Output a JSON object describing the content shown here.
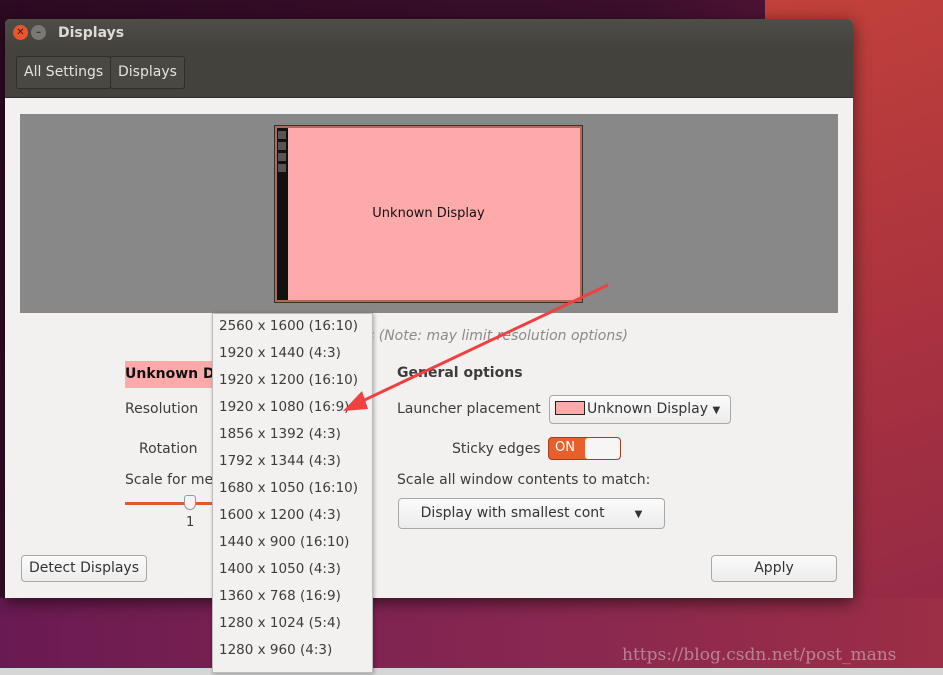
{
  "window": {
    "title": "Displays"
  },
  "toolbar": {
    "all_settings": "All Settings",
    "displays": "Displays"
  },
  "preview": {
    "monitor_label": "Unknown Display"
  },
  "note": "s (Note: may limit resolution options)",
  "display": {
    "name": "Unknown Di",
    "resolution_label": "Resolution",
    "rotation_label": "Rotation",
    "scale_label": "Scale for mer",
    "scale_value": "1"
  },
  "general": {
    "title": "General options",
    "launcher_label": "Launcher placement",
    "launcher_value": "Unknown Display",
    "sticky_label": "Sticky edges",
    "sticky_value": "ON",
    "scale_all_label": "Scale all window contents to match:",
    "scale_all_value": "Display with smallest cont"
  },
  "buttons": {
    "detect": "Detect Displays",
    "apply": "Apply"
  },
  "resolution_menu": [
    "2560 x 1600 (16:10)",
    "1920 x 1440 (4:3)",
    "1920 x 1200 (16:10)",
    "1920 x 1080 (16:9)",
    "1856 x 1392 (4:3)",
    "1792 x 1344 (4:3)",
    "1680 x 1050 (16:10)",
    "1600 x 1200 (4:3)",
    "1440 x 900 (16:10)",
    "1400 x 1050 (4:3)",
    "1360 x 768 (16:9)",
    "1280 x 1024 (5:4)",
    "1280 x 960 (4:3)"
  ],
  "watermark": "https://blog.csdn.net/post_mans",
  "colors": {
    "accent": "#e95f2c",
    "monitor": "#ffaaaa",
    "arrow": "#f04040"
  }
}
